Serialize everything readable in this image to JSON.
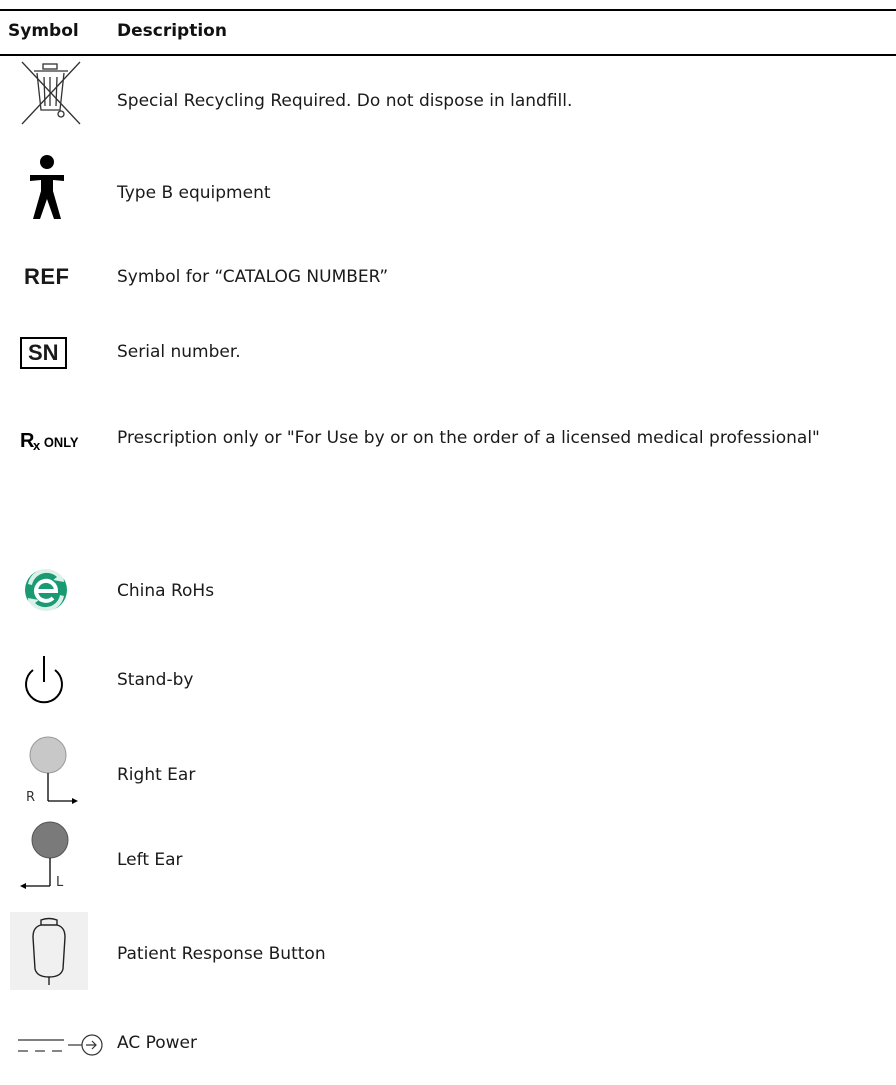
{
  "header": {
    "symbol": "Symbol",
    "description": "Description"
  },
  "rows": [
    {
      "icon": "weee-crossed-bin-icon",
      "description": "Special Recycling Required. Do not dispose in landfill."
    },
    {
      "icon": "type-b-person-icon",
      "description": "Type B equipment"
    },
    {
      "icon": "ref-icon",
      "symbol_text": "REF",
      "description": "Symbol for “CATALOG NUMBER”"
    },
    {
      "icon": "serial-number-icon",
      "symbol_text": "SN",
      "description": "Serial number."
    },
    {
      "icon": "rx-only-icon",
      "symbol_text": "Rx ONLY",
      "description": "Prescription only or \"For Use by or on the order of a licensed medical professional\""
    },
    {
      "icon": "china-rohs-icon",
      "description": "China RoHs"
    },
    {
      "icon": "standby-icon",
      "description": "Stand-by"
    },
    {
      "icon": "right-ear-icon",
      "symbol_text": "R",
      "description": "Right Ear"
    },
    {
      "icon": "left-ear-icon",
      "symbol_text": "L",
      "description": "Left Ear"
    },
    {
      "icon": "patient-response-button-icon",
      "description": "Patient Response Button"
    },
    {
      "icon": "ac-power-icon",
      "description": "AC Power"
    }
  ],
  "colors": {
    "rohs_green": "#1a9a72",
    "right_ear_gray": "#c8c8c8",
    "left_ear_gray": "#7a7a7a"
  }
}
